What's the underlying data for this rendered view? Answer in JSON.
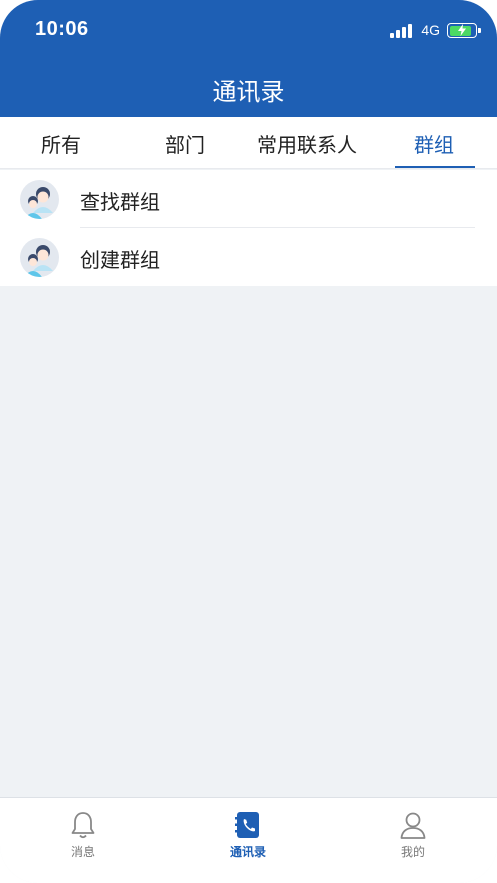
{
  "status_bar": {
    "time": "10:06",
    "network": "4G"
  },
  "header": {
    "title": "通讯录"
  },
  "tabs": [
    {
      "label": "所有"
    },
    {
      "label": "部门"
    },
    {
      "label": "常用联系人"
    },
    {
      "label": "群组",
      "active": true
    }
  ],
  "list": [
    {
      "label": "查找群组",
      "icon": "group-avatar-icon"
    },
    {
      "label": "创建群组",
      "icon": "group-avatar-icon"
    }
  ],
  "bottom_nav": [
    {
      "label": "消息",
      "icon": "bell-icon"
    },
    {
      "label": "通讯录",
      "icon": "contacts-book-icon",
      "active": true
    },
    {
      "label": "我的",
      "icon": "person-icon"
    }
  ],
  "colors": {
    "primary": "#1e5fb4",
    "background": "#eff2f5"
  }
}
